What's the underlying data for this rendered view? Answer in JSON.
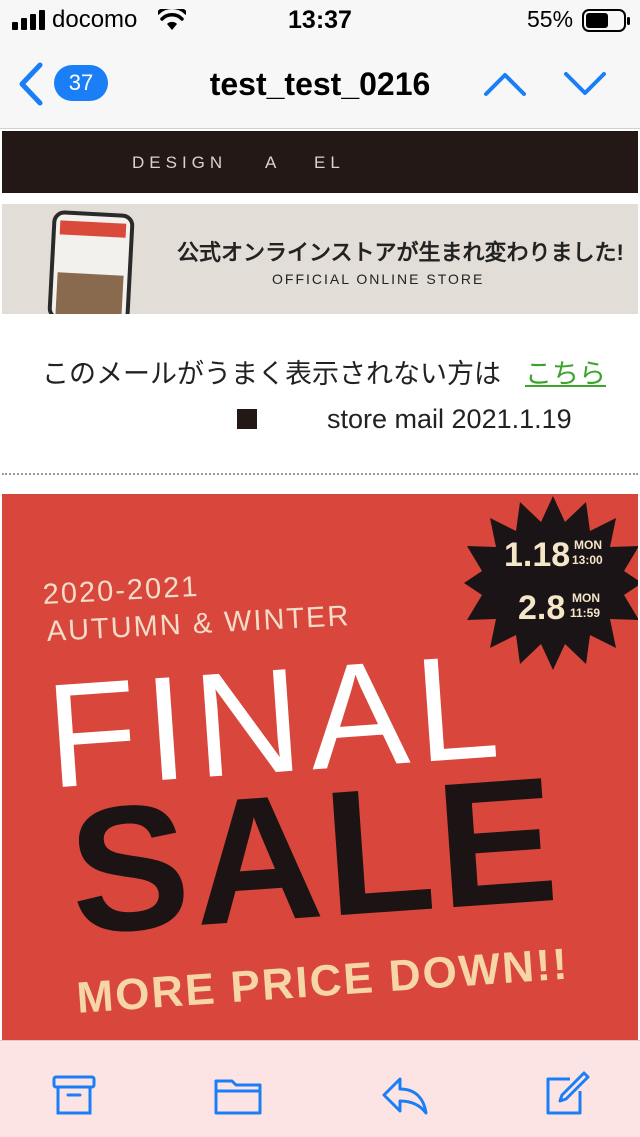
{
  "status_bar": {
    "carrier": "docomo",
    "time": "13:37",
    "battery": "55%"
  },
  "nav": {
    "unread_count": "37",
    "title": "test_test_0216"
  },
  "email": {
    "logo_words": [
      "DESIGN",
      "A",
      "EL"
    ],
    "banner_jp": "公式オンラインストアが生まれ変わりました!",
    "banner_en": "OFFICIAL ONLINE STORE",
    "view_text": "このメールがうまく表示されない方は",
    "view_link": "こちら",
    "mail_label": "store mail 2021.1.19",
    "sale": {
      "season_years": "2020-2021",
      "season_name": "AUTUMN & WINTER",
      "final": "FINAL",
      "sale": "SALE",
      "tagline": "MORE PRICE DOWN!!",
      "start_date": "1.18",
      "start_day": "MON",
      "start_time": "13:00",
      "end_date": "2.8",
      "end_day": "MON",
      "end_time": "11:59"
    }
  },
  "colors": {
    "accent": "#1a7ff6",
    "sale_bg": "#d9473c",
    "link": "#3aa52a",
    "toolbar_bg": "#fce4e4"
  },
  "toolbar": {
    "icons": [
      "archive-icon",
      "folder-icon",
      "reply-icon",
      "compose-icon"
    ]
  }
}
